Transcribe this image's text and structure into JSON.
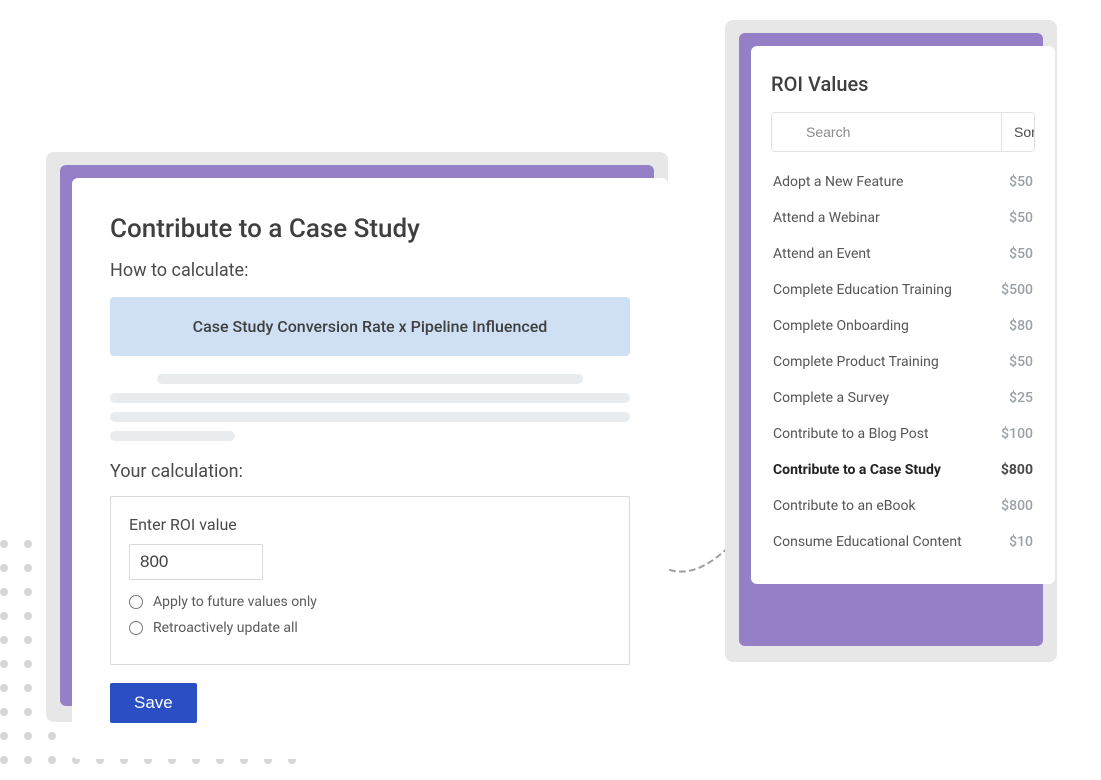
{
  "left": {
    "title": "Contribute to a Case Study",
    "how_label": "How to calculate:",
    "formula": "Case Study Conversion Rate x Pipeline Influenced",
    "your_calc_label": "Your calculation:",
    "enter_label": "Enter ROI value",
    "roi_value": "800",
    "radio_future": "Apply to future values only",
    "radio_retro": "Retroactively update all",
    "save_label": "Save"
  },
  "right": {
    "title": "ROI Values",
    "search_placeholder": "Search",
    "sort_label": "Sort",
    "items": [
      {
        "label": "Adopt a New Feature",
        "value": "$50",
        "highlight": false
      },
      {
        "label": "Attend a Webinar",
        "value": "$50",
        "highlight": false
      },
      {
        "label": "Attend an Event",
        "value": "$50",
        "highlight": false
      },
      {
        "label": "Complete Education Training",
        "value": "$500",
        "highlight": false
      },
      {
        "label": "Complete Onboarding",
        "value": "$80",
        "highlight": false
      },
      {
        "label": "Complete Product Training",
        "value": "$50",
        "highlight": false
      },
      {
        "label": "Complete a Survey",
        "value": "$25",
        "highlight": false
      },
      {
        "label": "Contribute to a Blog Post",
        "value": "$100",
        "highlight": false
      },
      {
        "label": "Contribute to a Case Study",
        "value": "$800",
        "highlight": true
      },
      {
        "label": "Contribute to an eBook",
        "value": "$800",
        "highlight": false
      },
      {
        "label": "Consume Educational Content",
        "value": "$10",
        "highlight": false
      }
    ]
  }
}
